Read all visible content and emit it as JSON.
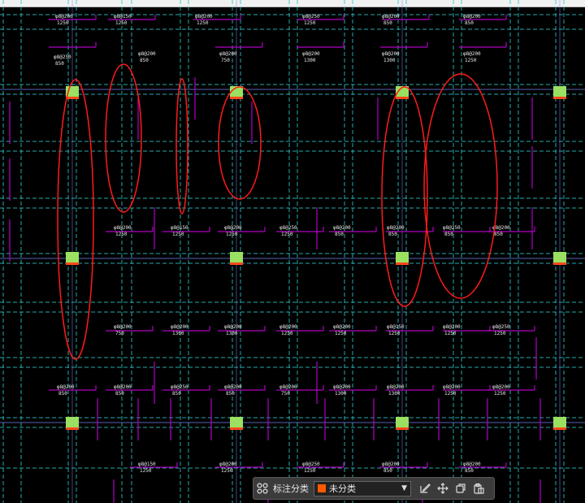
{
  "drawing": {
    "column_labels": [
      "φ8@200",
      "φ8@150",
      "φ8@200",
      "φ8@250",
      "φ8@200",
      "φ8@200",
      "φ8@250",
      "φ8@200",
      "φ8@200",
      "φ8@200",
      "φ8@200",
      "φ8@200"
    ],
    "length_labels": [
      "1250",
      "1250",
      "1250",
      "1250",
      "850",
      "850",
      "850",
      "850",
      "750",
      "1300",
      "1300",
      "1250"
    ],
    "grid_color": "#2fc6c6",
    "rebar_color": "#b000c4",
    "column_color": "#9be060",
    "markup_color": "#ff1a1a"
  },
  "toolbar": {
    "label": "标注分类",
    "category_value": "未分类",
    "category_color": "#ff5a00",
    "icons": [
      "grid-icon",
      "edit-icon",
      "move-icon",
      "copy-icon",
      "paste-icon"
    ]
  }
}
